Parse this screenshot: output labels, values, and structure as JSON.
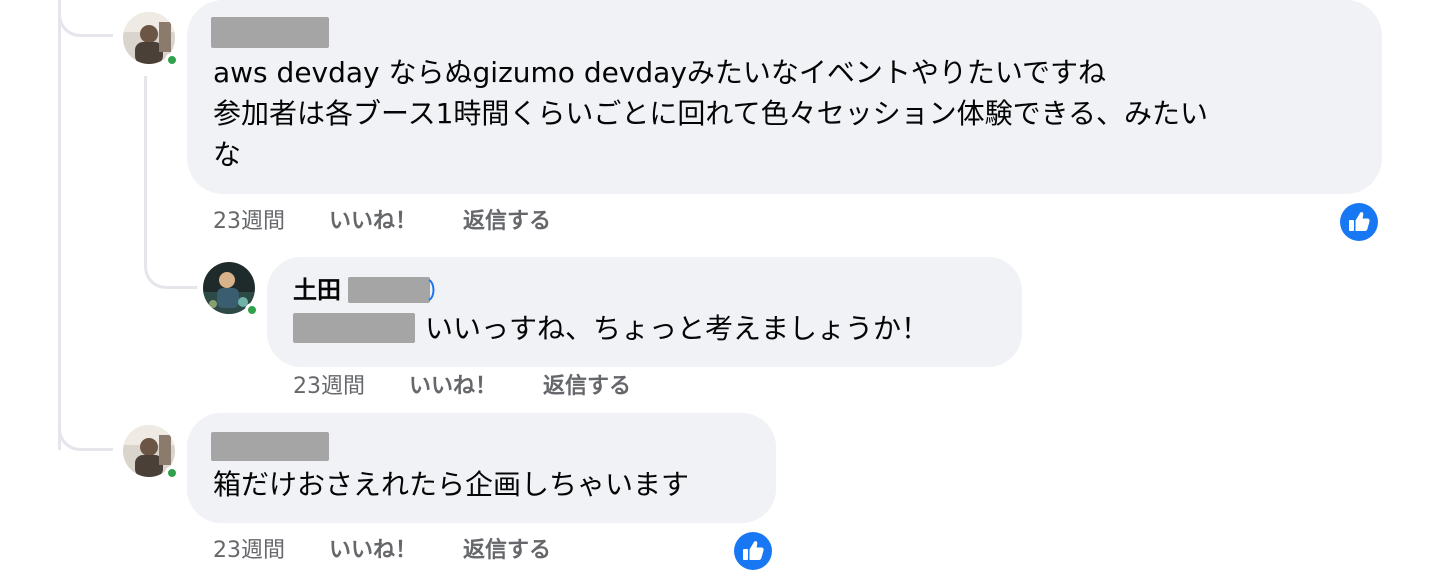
{
  "comments": [
    {
      "text_lines": [
        "aws devday ならぬgizumo devdayみたいなイベントやりたいですね",
        "参加者は各ブース1時間くらいごとに回れて色々セッション体験できる、みたい",
        "な"
      ],
      "time": "23週間",
      "like_label": "いいね！",
      "reply_label": "返信する"
    },
    {
      "author_prefix": "土田",
      "text": "いいっすね、ちょっと考えましょうか！",
      "time": "23週間",
      "like_label": "いいね！",
      "reply_label": "返信する"
    },
    {
      "text": "箱だけおさえれたら企画しちゃいます",
      "time": "23週間",
      "like_label": "いいね！",
      "reply_label": "返信する"
    }
  ],
  "colors": {
    "bubble_bg": "#f0f2f5",
    "like_blue": "#1877f2",
    "online_green": "#31a24c",
    "meta_gray": "#65676b",
    "redaction_gray": "#a5a5a5"
  },
  "icons": {
    "like_reaction": "thumbs-up-icon",
    "presence": "online-dot"
  }
}
